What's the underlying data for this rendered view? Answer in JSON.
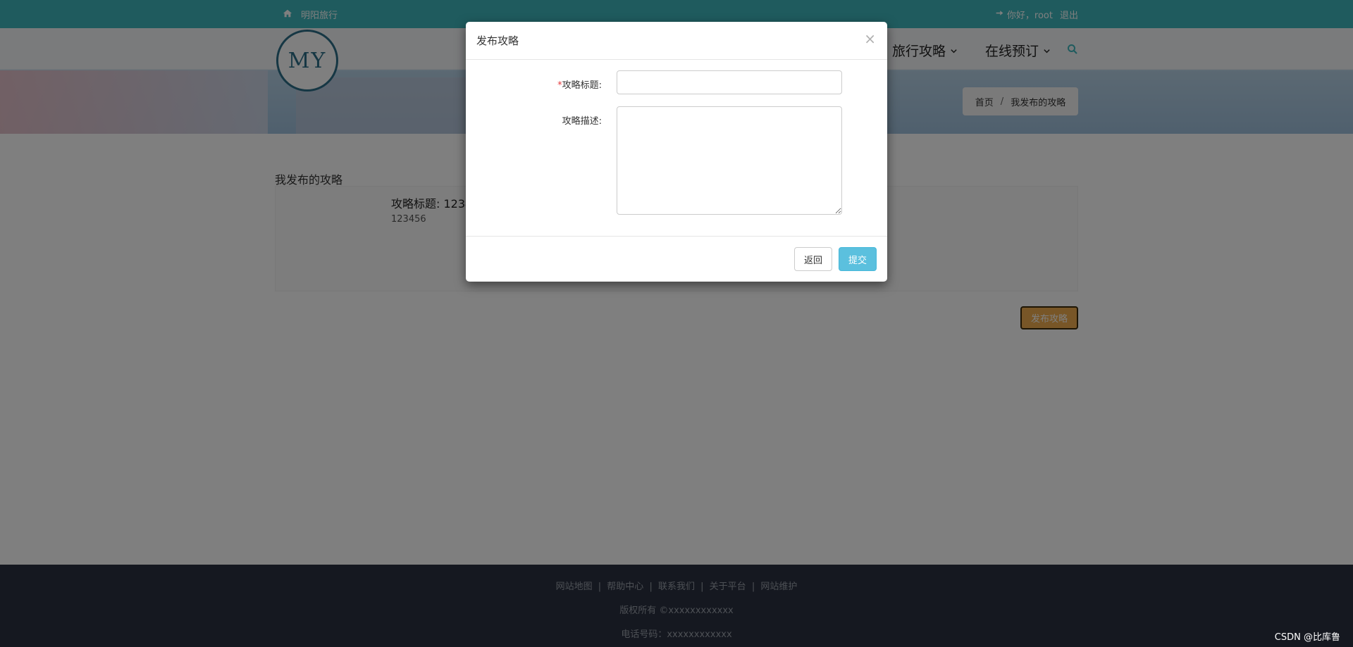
{
  "topbar": {
    "home_icon": "home-icon",
    "site_name": "明阳旅行",
    "login_icon": "sign-in-icon",
    "greeting": "你好，root",
    "logout": "退出"
  },
  "header": {
    "logo_text": "MY",
    "nav": [
      {
        "label": "旅行攻略",
        "icon": "chevron-down-icon"
      },
      {
        "label": "在线预订",
        "icon": "chevron-down-icon"
      }
    ],
    "search_icon": "search-icon"
  },
  "breadcrumb": {
    "home": "首页",
    "separator": "/",
    "current": "我发布的攻略"
  },
  "main": {
    "section_title": "我发布的攻略",
    "cards": [
      {
        "title": "攻略标题: 1234",
        "description": "123456"
      }
    ],
    "publish_button": "发布攻略"
  },
  "modal": {
    "title": "发布攻略",
    "close": "×",
    "fields": {
      "title_required_mark": "*",
      "title_label": "攻略标题:",
      "title_value": "",
      "description_label": "攻略描述:",
      "description_value": ""
    },
    "buttons": {
      "back": "返回",
      "submit": "提交"
    }
  },
  "footer": {
    "links": [
      "网站地图",
      "帮助中心",
      "联系我们",
      "关于平台",
      "网站维护"
    ],
    "separator": "|",
    "copyright": "版权所有 ©xxxxxxxxxxxx",
    "phone": "电话号码：xxxxxxxxxxxx"
  },
  "watermark": "CSDN @比库鲁",
  "colors": {
    "topbar": "#3fb7bd",
    "publish_button": "#f0ad4e",
    "submit_button": "#5bc0de",
    "footer": "#2b3140"
  }
}
